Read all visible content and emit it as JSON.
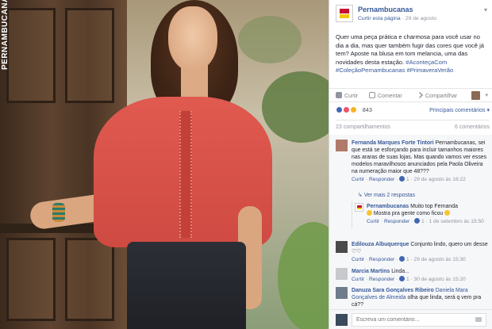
{
  "photo": {
    "brand_text": "PERNAMBUCANAS"
  },
  "post": {
    "page_name": "Pernambucanas",
    "like_page": "Curtir esta página",
    "date": "29 de agosto",
    "text": "Quer uma peça prática e charmosa para você usar no dia a dia, mas quer também fugir das cores que você já tem? Aposte na blusa em tom melancia, uma das novidades desta estação.",
    "hashtags": "#AconteçaCom #ColeçãoPernambucanas #PrimaveraVerão"
  },
  "actions": {
    "like": "Curtir",
    "comment": "Comentar",
    "share": "Compartilhar"
  },
  "reactions": {
    "count": "843",
    "top_comments": "Principais comentários",
    "shares": "23 compartilhamentos",
    "comments_count": "6 comentários"
  },
  "comments": [
    {
      "name": "Fernanda Marques Forte Tintori",
      "text": "Pernambucanas, sei que está se esforçando para incluir tamanhos maiores nas araras de suas lojas. Mas quando vamos ver esses modelos maravilhosos anunciados pela Paola Oliveira na numeração maior que 48???",
      "like": "Curtir",
      "reply": "Responder",
      "likes": "1",
      "date": "29 de agosto às 16:22"
    },
    {
      "name": "Edilouza Albuquerque",
      "text": "Conjunto lindo, quero um desse",
      "like": "Curtir",
      "reply": "Responder",
      "likes": "1",
      "date": "29 de agosto às 15:30"
    },
    {
      "name": "Marcia Martins",
      "text": "Linda...",
      "like": "Curtir",
      "reply": "Responder",
      "likes": "1",
      "date": "30 de agosto às 15:20"
    },
    {
      "name": "Danuza Sara Gonçalves Ribeiro",
      "tag": "Daniela Mara Gonçalves de Almeida",
      "text": "olha que linda, será q vem pra cá??",
      "like": "Curtir",
      "reply": "Responder",
      "likes": "",
      "date": ""
    }
  ],
  "more_replies": "Ver mais 2 respostas",
  "page_reply": {
    "name": "Pernambucanas",
    "text": "Muito top Fernanda",
    "text2": "Mostra pra gente como ficou",
    "like": "Curtir",
    "reply": "Responder",
    "likes": "1",
    "date": "1 de setembro às 15:50"
  },
  "write": {
    "placeholder": "Escreva um comentário..."
  }
}
